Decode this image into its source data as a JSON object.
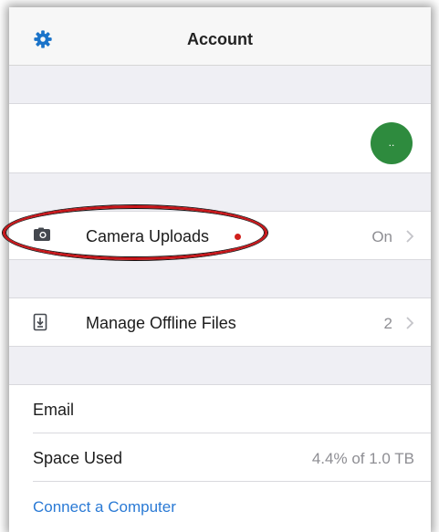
{
  "navbar": {
    "title": "Account",
    "settings_icon": "gear-icon"
  },
  "profile": {
    "avatar_text": "..",
    "avatar_color": "#2e8b3e"
  },
  "camera_uploads": {
    "icon": "camera-icon",
    "label": "Camera Uploads",
    "value": "On",
    "status_dot_color": "#d0201c"
  },
  "offline_files": {
    "icon": "download-file-icon",
    "label": "Manage Offline Files",
    "value": "2"
  },
  "account_info": {
    "email_label": "Email",
    "space_used_label": "Space Used",
    "space_used_value": "4.4% of 1.0 TB",
    "connect_label": "Connect a Computer"
  },
  "colors": {
    "accent": "#2a7ad5",
    "group_background": "#efeff4",
    "highlight_oval": "#c8161a"
  }
}
